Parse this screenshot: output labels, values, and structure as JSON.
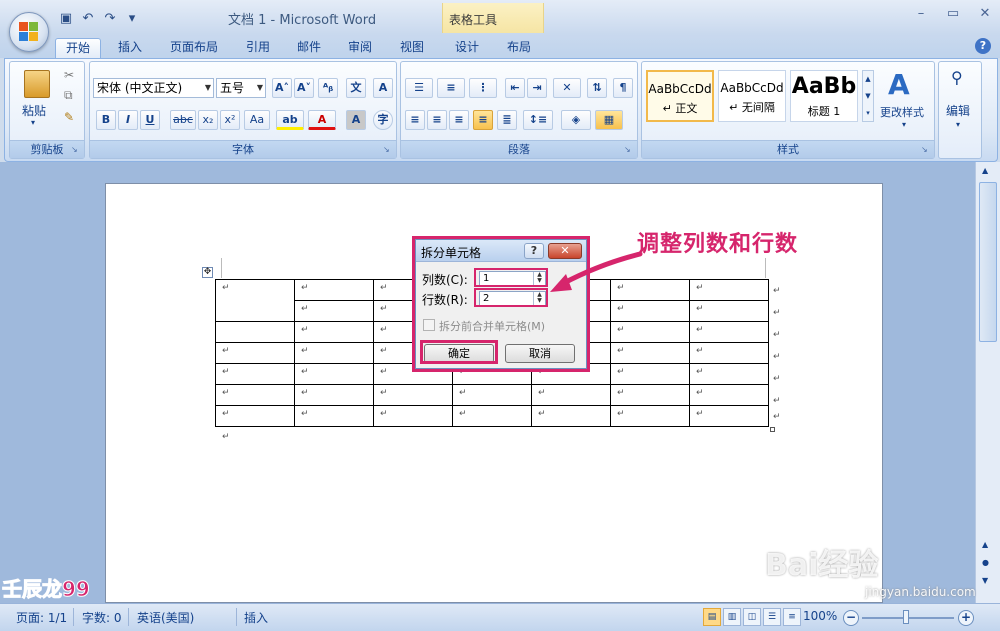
{
  "window": {
    "title": "文档 1 - Microsoft Word",
    "context_tab_title": "表格工具"
  },
  "tabs": [
    {
      "label": "开始",
      "active": true
    },
    {
      "label": "插入"
    },
    {
      "label": "页面布局"
    },
    {
      "label": "引用"
    },
    {
      "label": "邮件"
    },
    {
      "label": "审阅"
    },
    {
      "label": "视图"
    },
    {
      "label": "设计"
    },
    {
      "label": "布局"
    }
  ],
  "ribbon": {
    "clipboard": {
      "paste_label": "粘贴",
      "group_label": "剪贴板"
    },
    "font": {
      "font_name": "宋体 (中文正文)",
      "font_size": "五号",
      "group_label": "字体"
    },
    "paragraph": {
      "group_label": "段落"
    },
    "styles": {
      "group_label": "样式",
      "items": [
        {
          "sample": "AaBbCcDd",
          "name": "↵ 正文"
        },
        {
          "sample": "AaBbCcDd",
          "name": "↵ 无间隔"
        },
        {
          "sample": "AaBb",
          "name": "标题 1"
        }
      ],
      "change_styles_label": "更改样式"
    },
    "editing": {
      "label": "编辑"
    }
  },
  "dialog": {
    "title": "拆分单元格",
    "help": "?",
    "close": "✕",
    "columns_label": "列数(C):",
    "columns_value": "1",
    "rows_label": "行数(R):",
    "rows_value": "2",
    "merge_checkbox_label": "拆分前合并单元格(M)",
    "ok_label": "确定",
    "cancel_label": "取消"
  },
  "annotation": {
    "text": "调整列数和行数"
  },
  "watermarks": {
    "author": "壬辰龙99",
    "baidu": "Bai经验",
    "site": "jingyan.baidu.com"
  },
  "statusbar": {
    "page": "页面: 1/1",
    "words": "字数: 0",
    "language": "英语(美国)",
    "mode": "插入",
    "zoom": "100%"
  }
}
